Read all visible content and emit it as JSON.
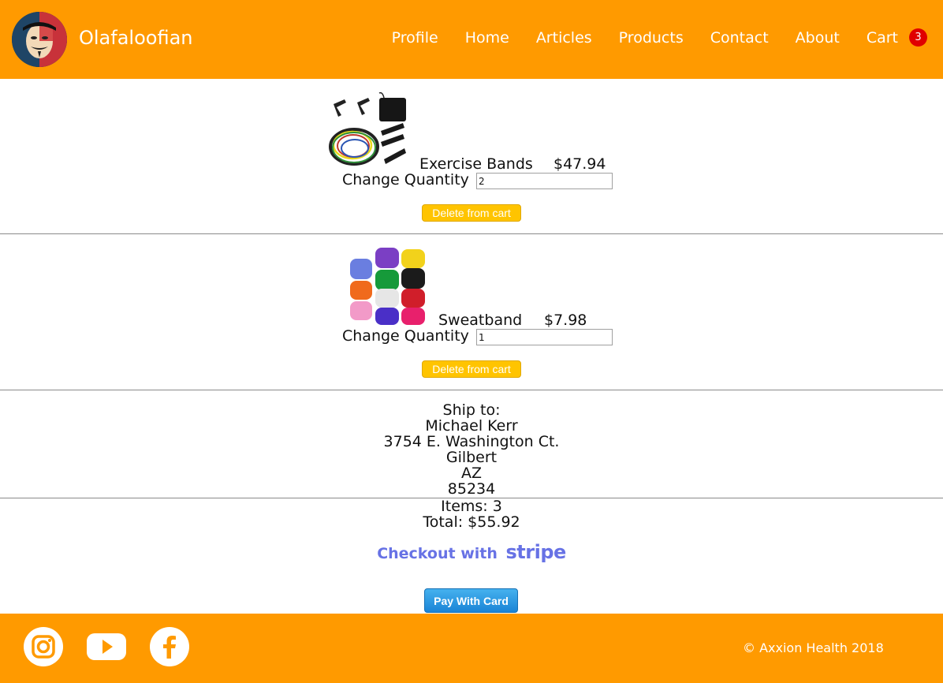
{
  "header": {
    "site_name": "Olafaloofian",
    "nav": {
      "profile": "Profile",
      "home": "Home",
      "articles": "Articles",
      "products": "Products",
      "contact": "Contact",
      "about": "About",
      "cart": "Cart"
    },
    "cart_count": "3"
  },
  "cart": {
    "items": [
      {
        "name": "Exercise Bands",
        "price": "$47.94",
        "qty_label": "Change Quantity",
        "quantity": "2",
        "delete_label": "Delete from cart",
        "image_icon": "exercise-bands-image"
      },
      {
        "name": "Sweatband",
        "price": "$7.98",
        "qty_label": "Change Quantity",
        "quantity": "1",
        "delete_label": "Delete from cart",
        "image_icon": "sweatband-image"
      }
    ]
  },
  "shipping": {
    "heading": "Ship to:",
    "name": "Michael Kerr",
    "street": "3754 E. Washington Ct.",
    "city": "Gilbert",
    "state": "AZ",
    "zip": "85234"
  },
  "summary": {
    "items": "Items: 3",
    "total": "Total: $55.92"
  },
  "checkout": {
    "text": "Checkout with",
    "brand": "stripe",
    "pay_label": "Pay With Card"
  },
  "footer": {
    "social": [
      "instagram-icon",
      "youtube-icon",
      "facebook-icon"
    ],
    "copyright": "© Axxion Health 2018"
  },
  "colors": {
    "brand_orange": "#ff9a00",
    "badge_red": "#e00000",
    "delete_yellow": "#ffc400",
    "stripe_purple": "#6772e5",
    "pay_blue": "#1a84d6"
  }
}
